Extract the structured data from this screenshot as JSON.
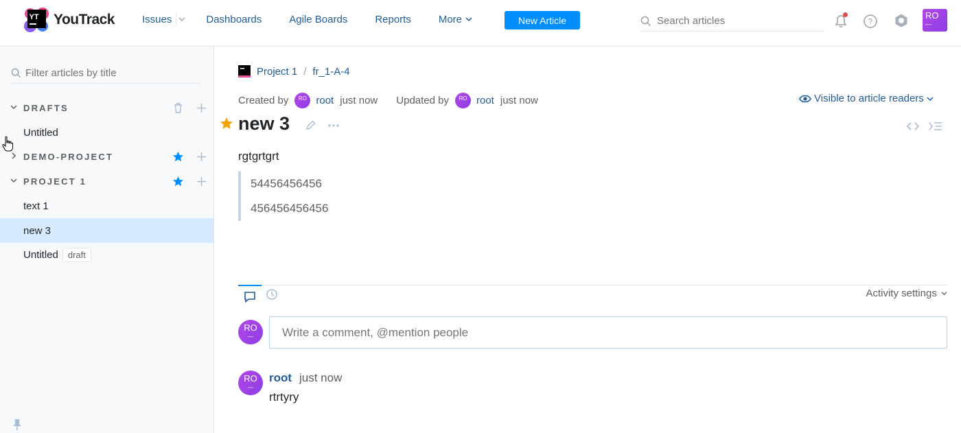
{
  "app": {
    "name": "YouTrack",
    "logo_text": "YT"
  },
  "nav": {
    "issues": "Issues",
    "dashboards": "Dashboards",
    "agile_boards": "Agile Boards",
    "reports": "Reports",
    "more": "More",
    "new_article": "New Article"
  },
  "search": {
    "placeholder": "Search articles"
  },
  "user": {
    "initials": "RO",
    "initials_sub": "—"
  },
  "sidebar": {
    "filter_placeholder": "Filter articles by title",
    "drafts": {
      "title": "DRAFTS",
      "items": [
        "Untitled"
      ]
    },
    "demo_project": {
      "title": "DEMO-PROJECT"
    },
    "project1": {
      "title": "PROJECT 1",
      "items": [
        {
          "label": "text 1"
        },
        {
          "label": "new 3"
        },
        {
          "label": "Untitled",
          "badge": "draft"
        }
      ]
    }
  },
  "article": {
    "breadcrumb": {
      "project": "Project 1",
      "separator": "/",
      "id": "fr_1-A-4"
    },
    "created_label": "Created by",
    "created_user": "root",
    "created_time": "just now",
    "updated_label": "Updated by",
    "updated_user": "root",
    "updated_time": "just now",
    "visibility": "Visible to article readers",
    "title": "new 3",
    "text": "rgtgrtgrt",
    "quote": [
      "54456456456",
      "456456456456"
    ]
  },
  "activity": {
    "settings_label": "Activity settings",
    "comment_placeholder": "Write a comment, @mention people",
    "comments": [
      {
        "author": "root",
        "time": "just now",
        "text": "rtrtyry"
      }
    ]
  },
  "colors": {
    "accent": "#008eff",
    "link": "#1f5c99",
    "selected": "#d6ebff",
    "star": "#f5a300"
  }
}
